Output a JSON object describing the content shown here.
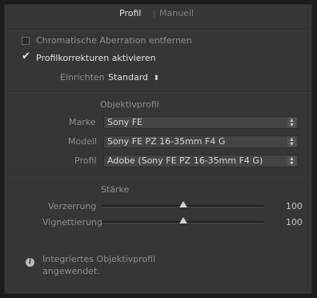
{
  "tabs": {
    "profil": "Profil",
    "separator": "|",
    "manuell": "Manuell"
  },
  "options": {
    "chromatic_label": "Chromatische Aberration entfernen",
    "chromatic_checked": false,
    "profile_corr_label": "Profilkorrekturen aktivieren",
    "profile_corr_checked": true,
    "setup_label": "Einrichten",
    "setup_value": "Standard",
    "setup_arrows": "⬍"
  },
  "lens_profile": {
    "heading": "Objektivprofil",
    "make_label": "Marke",
    "make_value": "Sony FE",
    "model_label": "Modell",
    "model_value": "Sony FE PZ 16-35mm F4 G",
    "profile_label": "Profil",
    "profile_value": "Adobe (Sony FE PZ 16-35mm F4 G)"
  },
  "amount": {
    "heading": "Stärke",
    "distortion_label": "Verzerrung",
    "distortion_value": "100",
    "vignetting_label": "Vignettierung",
    "vignetting_value": "100"
  },
  "info": {
    "icon": "i",
    "line1": "Integriertes Objektivprofil",
    "line2": "angewendet."
  }
}
